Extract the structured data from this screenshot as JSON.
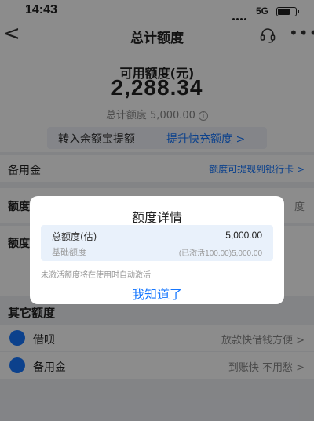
{
  "status": {
    "time": "14:43",
    "network": "5G"
  },
  "nav": {
    "back_glyph": "<",
    "title": "总计额度",
    "more_glyph": "•••"
  },
  "hero": {
    "label": "可用额度(元)",
    "amount": "2,288.34",
    "total": "总计额度 5,000.00",
    "info_glyph": "i",
    "transfer": "转入余额宝提额",
    "upgrade": "提升快充额度 >"
  },
  "rows": {
    "reserve": {
      "label": "备用金",
      "link": "额度可提现到银行卡 >"
    },
    "row2_label": "额度",
    "row2_right": "度",
    "row3_label": "额度"
  },
  "other": {
    "title": "其它额度",
    "items": [
      {
        "label": "借呗",
        "right": "放款快借钱方便 >",
        "icon": "jiebei-icon"
      },
      {
        "label": "备用金",
        "right": "到账快 不用愁 >",
        "icon": "reserve-icon"
      }
    ]
  },
  "dialog": {
    "title": "额度详情",
    "total_label": "总额度(估)",
    "total_value": "5,000.00",
    "base_label": "基础额度",
    "base_value": "(已激活100.00)5,000.00",
    "note": "未激活额度将在使用时自动激活",
    "confirm": "我知道了"
  },
  "colors": {
    "accent": "#1677ff",
    "overlay": "rgba(0,0,0,0.45)"
  }
}
